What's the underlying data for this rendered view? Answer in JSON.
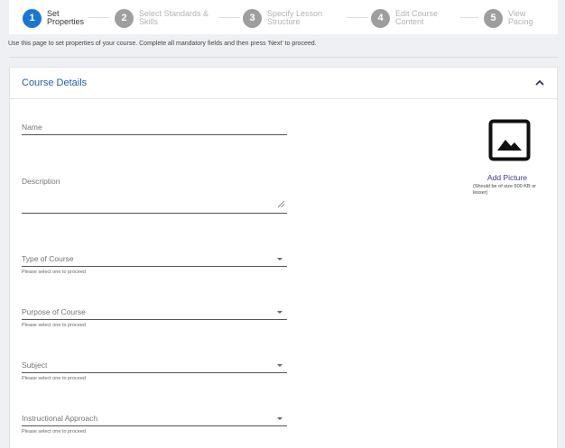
{
  "stepper": {
    "steps": [
      {
        "number": "1",
        "label": "Set Properties"
      },
      {
        "number": "2",
        "label": "Select Standards & Skills"
      },
      {
        "number": "3",
        "label": "Specify Lesson Structure"
      },
      {
        "number": "4",
        "label": "Edit Course Content"
      },
      {
        "number": "5",
        "label": "View Pacing"
      }
    ]
  },
  "instructions": "Use this page to set properties of your course. Complete all mandatory fields and then press 'Next' to proceed.",
  "card": {
    "title": "Course Details",
    "fields": {
      "name": {
        "label": "Name"
      },
      "description": {
        "label": "Description"
      },
      "type": {
        "label": "Type of Course",
        "hint": "Please select one to proceed"
      },
      "purpose": {
        "label": "Purpose of Course",
        "hint": "Please select one to proceed"
      },
      "subject": {
        "label": "Subject",
        "hint": "Please select one to proceed"
      },
      "approach": {
        "label": "Instructional Approach",
        "hint": "Please select one to proceed"
      }
    },
    "picture": {
      "add_label": "Add Picture",
      "note": "(Should be of size 500 KB or lesser)"
    }
  }
}
